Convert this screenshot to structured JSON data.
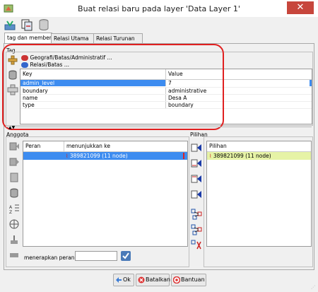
{
  "window": {
    "title": "Buat relasi baru pada layer 'Data Layer 1'",
    "close_glyph": "✕"
  },
  "toolbar": {
    "icons": [
      "apply-icon",
      "copy-relation-icon",
      "database-icon"
    ]
  },
  "tabs": [
    {
      "label": "tag dan member",
      "active": true
    },
    {
      "label": "Relasi Utama",
      "active": false
    },
    {
      "label": "Relasi Turunan",
      "active": false
    }
  ],
  "tag_section": {
    "label": "Tag",
    "presets": [
      "Geografi/Batas/Administratif ...",
      "Relasi/Batas ..."
    ],
    "columns": [
      "Key",
      "Value"
    ],
    "rows": [
      {
        "key": "admin_level",
        "value": "7",
        "selected": true
      },
      {
        "key": "boundary",
        "value": "administrative",
        "selected": false
      },
      {
        "key": "name",
        "value": "Desa A",
        "selected": false
      },
      {
        "key": "type",
        "value": "boundary",
        "selected": false
      }
    ],
    "highlight_color": "#e02020"
  },
  "members_section": {
    "label": "Anggota",
    "columns": [
      "Peran",
      "menunjukkan ke"
    ],
    "rows": [
      {
        "role": "",
        "ref": "389821099 (11 node)"
      }
    ],
    "apply_role_label": "menerapkan peran",
    "apply_role_value": ""
  },
  "selection_section": {
    "label": "Pilihan",
    "column": "Pilihan",
    "rows": [
      {
        "ref": "389821099 (11 node)"
      }
    ]
  },
  "buttons": {
    "ok": "Ok",
    "cancel": "Batalkan",
    "help": "Bantuan"
  },
  "colors": {
    "selection_blue": "#3d8cf0",
    "selection_green": "#e6f3a6",
    "close_red": "#c7463c"
  }
}
